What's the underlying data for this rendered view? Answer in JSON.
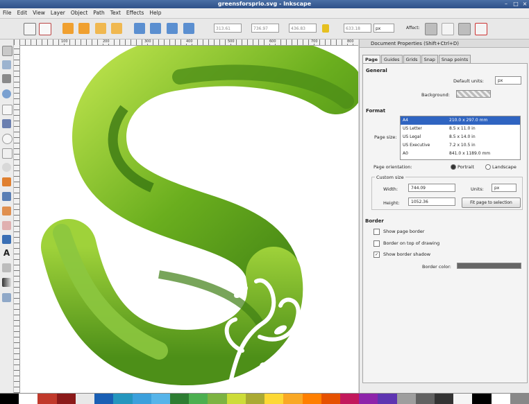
{
  "window": {
    "title": "greensforsprio.svg - Inkscape"
  },
  "menu": [
    "File",
    "Edit",
    "View",
    "Layer",
    "Object",
    "Path",
    "Text",
    "Effects",
    "Help"
  ],
  "toolbar": {
    "x_value": "313.61",
    "y_value": "736.97",
    "w_value": "436.83",
    "h_value": "633.18",
    "unit": "px",
    "affect_label": "Affect:"
  },
  "ruler": {
    "marks": [
      "100",
      "200",
      "300",
      "400",
      "500",
      "600",
      "700",
      "800"
    ]
  },
  "dock": {
    "title": "Document Properties (Shift+Ctrl+D)",
    "tabs": [
      "Page",
      "Guides",
      "Grids",
      "Snap",
      "Snap points"
    ],
    "general_heading": "General",
    "default_units_label": "Default units:",
    "default_units_value": "px",
    "background_label": "Background:",
    "format_heading": "Format",
    "page_size_label": "Page size:",
    "page_sizes": [
      {
        "name": "A4",
        "dim": "210.0 x 297.0 mm"
      },
      {
        "name": "US Letter",
        "dim": "8.5 x 11.0 in"
      },
      {
        "name": "US Legal",
        "dim": "8.5 x 14.0 in"
      },
      {
        "name": "US Executive",
        "dim": "7.2 x 10.5 in"
      },
      {
        "name": "A0",
        "dim": "841.0 x 1189.0 mm"
      }
    ],
    "orientation_label": "Page orientation:",
    "portrait_label": "Portrait",
    "landscape_label": "Landscape",
    "custom_size_label": "Custom size",
    "width_label": "Width:",
    "width_value": "744.09",
    "height_label": "Height:",
    "height_value": "1052.36",
    "units_label": "Units:",
    "units_value": "px",
    "fit_button": "Fit page to selection",
    "border_heading": "Border",
    "show_page_border": "Show page border",
    "border_on_top": "Border on top of drawing",
    "show_border_shadow": "Show border shadow",
    "border_color_label": "Border color:"
  },
  "palette": [
    "#000000",
    "#ffffff",
    "#c0392b",
    "#8b1a1a",
    "#e8e8e8",
    "#1a5fb4",
    "#2596be",
    "#3ca0dc",
    "#56b4e9",
    "#2e7d32",
    "#4caf50",
    "#7cb342",
    "#cddc39",
    "#aaaa33",
    "#fdd835",
    "#f9a825",
    "#ff7f00",
    "#e65100",
    "#c2185b",
    "#8e24aa",
    "#5e35b1",
    "#9e9e9e",
    "#616161",
    "#333333",
    "#f5f5f5",
    "#000000",
    "#ffffff",
    "#888888"
  ],
  "colors": {
    "title_bg": "#3b5e98",
    "green_dark": "#3f7f14",
    "green_light": "#9fd23a"
  }
}
